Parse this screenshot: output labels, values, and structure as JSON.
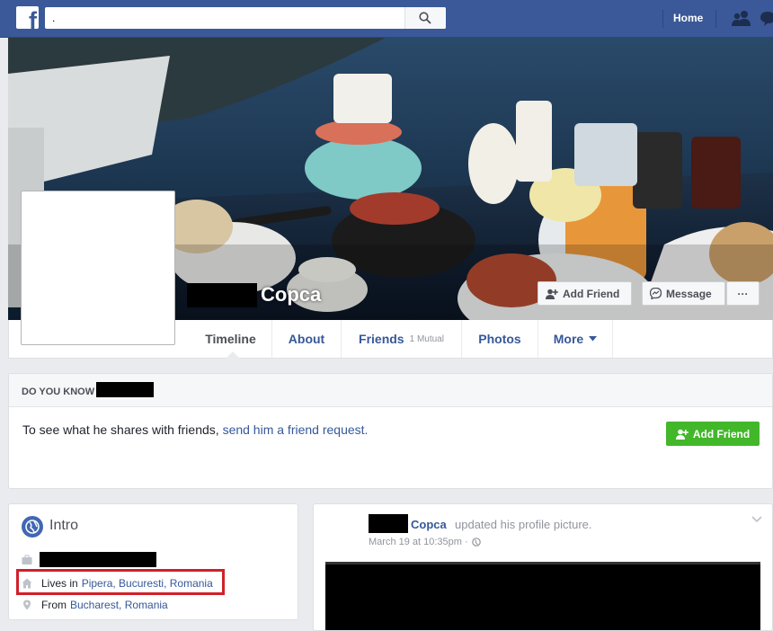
{
  "topbar": {
    "logo_letter": "f",
    "search_value": ".",
    "home_label": "Home"
  },
  "profile": {
    "name": "Copca"
  },
  "cover_buttons": {
    "add_friend": "Add Friend",
    "message": "Message",
    "more": "···"
  },
  "tabs": [
    {
      "label": "Timeline"
    },
    {
      "label": "About"
    },
    {
      "label": "Friends",
      "sub": "1 Mutual"
    },
    {
      "label": "Photos"
    },
    {
      "label": "More"
    }
  ],
  "do_you_know": {
    "title": "DO YOU KNOW",
    "text": "To see what he shares with friends, ",
    "link": "send him a friend request.",
    "button": "Add Friend"
  },
  "intro": {
    "title": "Intro",
    "lives_prefix": "Lives in",
    "lives_place": "Pipera, Bucuresti, Romania",
    "from_prefix": "From",
    "from_place": "Bucharest, Romania"
  },
  "post": {
    "author": "Copca",
    "action": "updated his profile picture.",
    "time": "March 19 at 10:35pm ·"
  },
  "colors": {
    "brand_blue": "#3b5998",
    "link_blue": "#365899",
    "green_button": "#42b72a",
    "highlight_red": "#d1202a"
  },
  "icons": [
    "search-icon",
    "friends-icon",
    "messages-icon",
    "add-friend-icon",
    "messenger-icon",
    "globe-icon",
    "briefcase-icon",
    "home-icon",
    "location-pin-icon",
    "chevron-down-icon",
    "public-globe-icon"
  ]
}
